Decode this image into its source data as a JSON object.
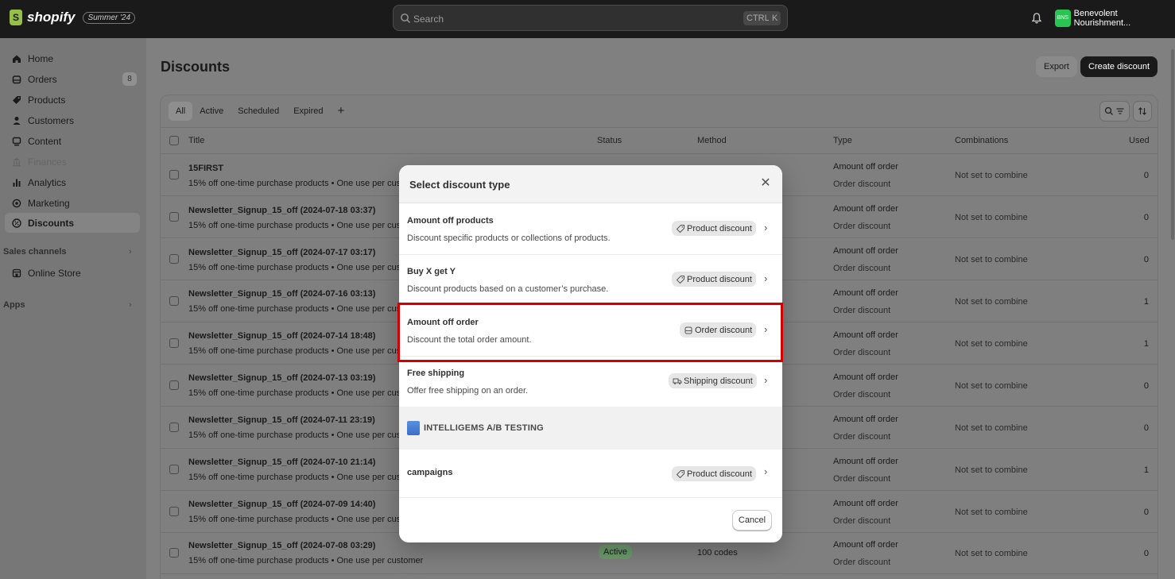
{
  "topbar": {
    "brand": "shopify",
    "edition_badge": "Summer '24",
    "search_placeholder": "Search",
    "shortcut_ctrl": "CTRL",
    "shortcut_key": "K",
    "store_initials": "BNS",
    "store_name": "Benevolent Nourishment..."
  },
  "sidebar": {
    "items": [
      {
        "label": "Home",
        "icon": "home-icon"
      },
      {
        "label": "Orders",
        "icon": "orders-icon",
        "count": "8"
      },
      {
        "label": "Products",
        "icon": "tag-icon"
      },
      {
        "label": "Customers",
        "icon": "person-icon"
      },
      {
        "label": "Content",
        "icon": "content-icon"
      },
      {
        "label": "Finances",
        "icon": "bank-icon"
      },
      {
        "label": "Analytics",
        "icon": "bar-chart-icon"
      },
      {
        "label": "Marketing",
        "icon": "target-icon"
      },
      {
        "label": "Discounts",
        "icon": "discount-icon"
      }
    ],
    "sales_channels_label": "Sales channels",
    "online_store_label": "Online Store",
    "apps_label": "Apps"
  },
  "page": {
    "title": "Discounts",
    "export_label": "Export",
    "create_label": "Create discount"
  },
  "tabs": [
    "All",
    "Active",
    "Scheduled",
    "Expired",
    "+"
  ],
  "table": {
    "columns": [
      "Title",
      "Status",
      "Method",
      "Type",
      "Combinations",
      "Used"
    ],
    "rows": [
      {
        "title": "15FIRST",
        "summary": "15% off one-time purchase products • One use per customer",
        "type": "Amount off order",
        "type_sub": "Order discount",
        "combinations": "Not set to combine",
        "used": "0"
      },
      {
        "title": "Newsletter_Signup_15_off (2024-07-18 03:37)",
        "summary": "15% off one-time purchase products • One use per customer",
        "type": "Amount off order",
        "type_sub": "Order discount",
        "combinations": "Not set to combine",
        "used": "0"
      },
      {
        "title": "Newsletter_Signup_15_off (2024-07-17 03:17)",
        "summary": "15% off one-time purchase products • One use per customer",
        "type": "Amount off order",
        "type_sub": "Order discount",
        "combinations": "Not set to combine",
        "used": "0"
      },
      {
        "title": "Newsletter_Signup_15_off (2024-07-16 03:13)",
        "summary": "15% off one-time purchase products • One use per customer",
        "type": "Amount off order",
        "type_sub": "Order discount",
        "combinations": "Not set to combine",
        "used": "1"
      },
      {
        "title": "Newsletter_Signup_15_off (2024-07-14 18:48)",
        "summary": "15% off one-time purchase products • One use per customer",
        "type": "Amount off order",
        "type_sub": "Order discount",
        "combinations": "Not set to combine",
        "used": "1"
      },
      {
        "title": "Newsletter_Signup_15_off (2024-07-13 03:19)",
        "summary": "15% off one-time purchase products • One use per customer",
        "type": "Amount off order",
        "type_sub": "Order discount",
        "combinations": "Not set to combine",
        "used": "0"
      },
      {
        "title": "Newsletter_Signup_15_off (2024-07-11 23:19)",
        "summary": "15% off one-time purchase products • One use per customer",
        "type": "Amount off order",
        "type_sub": "Order discount",
        "combinations": "Not set to combine",
        "used": "0"
      },
      {
        "title": "Newsletter_Signup_15_off (2024-07-10 21:14)",
        "summary": "15% off one-time purchase products • One use per customer",
        "type": "Amount off order",
        "type_sub": "Order discount",
        "combinations": "Not set to combine",
        "used": "1"
      },
      {
        "title": "Newsletter_Signup_15_off (2024-07-09 14:40)",
        "summary": "15% off one-time purchase products • One use per customer",
        "type": "Amount off order",
        "type_sub": "Order discount",
        "combinations": "Not set to combine",
        "used": "0"
      },
      {
        "title": "Newsletter_Signup_15_off (2024-07-08 03:29)",
        "summary": "15% off one-time purchase products • One use per customer",
        "type": "Amount off order",
        "type_sub": "Order discount",
        "combinations": "Not set to combine",
        "used": "0",
        "status": "Active",
        "method": "100 codes"
      }
    ]
  },
  "modal": {
    "title": "Select discount type",
    "options": [
      {
        "title": "Amount off products",
        "description": "Discount specific products or collections of products.",
        "badge": "Product discount",
        "badge_icon": "tag-icon"
      },
      {
        "title": "Buy X get Y",
        "description": "Discount products based on a customer’s purchase.",
        "badge": "Product discount",
        "badge_icon": "tag-icon"
      },
      {
        "title": "Amount off order",
        "description": "Discount the total order amount.",
        "badge": "Order discount",
        "badge_icon": "cart-icon"
      },
      {
        "title": "Free shipping",
        "description": "Offer free shipping on an order.",
        "badge": "Shipping discount",
        "badge_icon": "truck-icon"
      }
    ],
    "app_section": "INTELLIGEMS A/B TESTING",
    "app_option": {
      "title": "campaigns",
      "badge": "Product discount"
    },
    "cancel_label": "Cancel"
  },
  "colors": {
    "highlight_border": "#d40000",
    "topbar_bg": "#1a1a1a",
    "primary_button": "#1a1a1a",
    "store_avatar": "#29c451"
  }
}
